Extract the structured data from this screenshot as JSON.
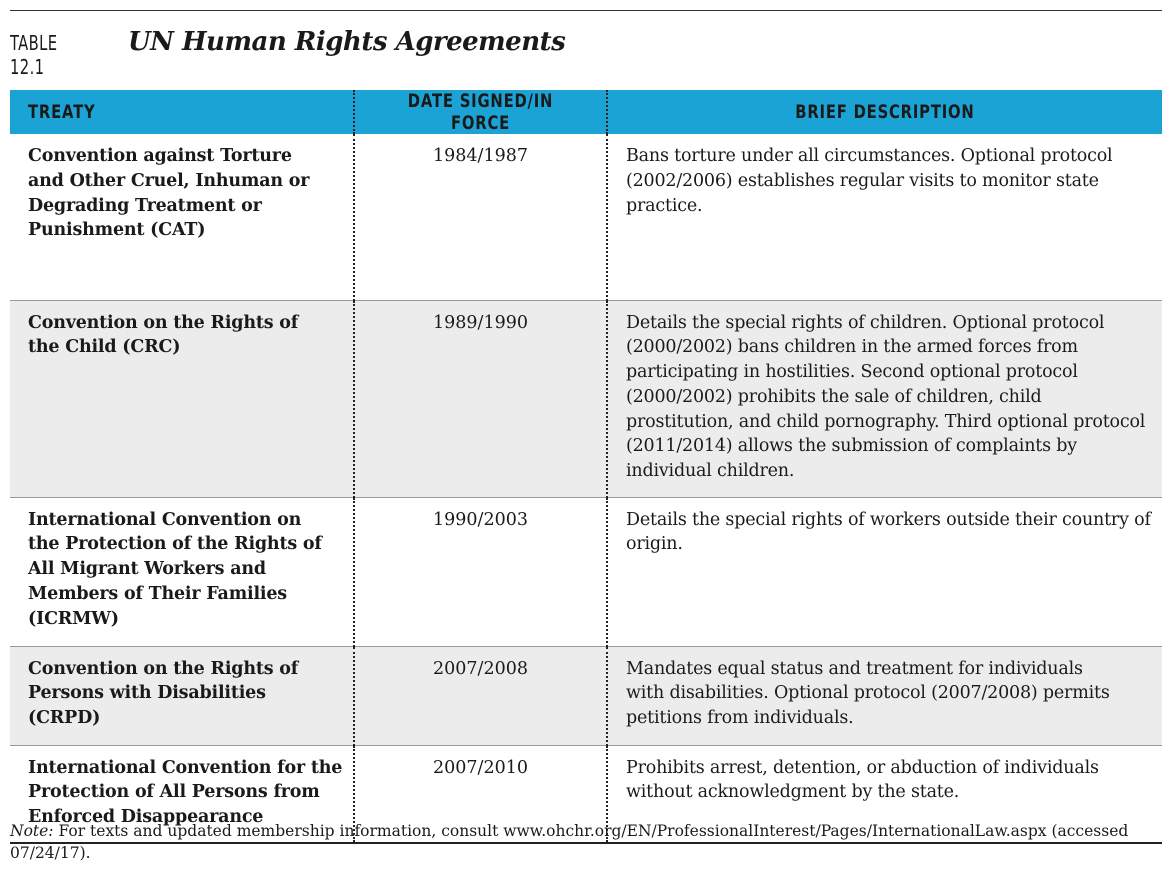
{
  "header": {
    "table_label": "TABLE 12.1",
    "table_title": "UN Human Rights Agreements"
  },
  "table": {
    "columns": [
      "TREATY",
      "DATE SIGNED/IN FORCE",
      "BRIEF DESCRIPTION"
    ],
    "rows": [
      {
        "treaty": "Convention against Torture and Other Cruel, Inhuman or Degrading Treatment or Punishment (CAT)",
        "date": "1984/1987",
        "description": "Bans torture under all circumstances. Optional protocol (2002/2006) establishes regular visits to monitor state practice."
      },
      {
        "treaty": "Convention on the Rights of the Child (CRC)",
        "date": "1989/1990",
        "description": "Details the special rights of children. Optional protocol (2000/2002) bans children in the armed forces from participating in hostilities. Second optional protocol (2000/2002) prohibits the sale of children, child prostitution, and child pornography. Third optional protocol (2011/2014) allows the submission of complaints by individual children."
      },
      {
        "treaty": "International Convention on the Protection of the Rights of All Migrant Workers and Members of Their Families (ICRMW)",
        "date": "1990/2003",
        "description": "Details the special rights of workers outside their country of origin."
      },
      {
        "treaty": "Convention on the Rights of Persons with Disabilities (CRPD)",
        "date": "2007/2008",
        "description": "Mandates equal status and treatment for individuals with disabilities. Optional protocol (2007/2008) permits petitions from individuals."
      },
      {
        "treaty": "International Convention for the Protection of All Persons from Enforced Disappearance",
        "date": "2007/2010",
        "description": "Prohibits arrest, detention, or abduction of individuals without acknowledgment by the state."
      }
    ]
  },
  "note": {
    "label": "Note:",
    "text": "For texts and updated membership information, consult www.ohchr.org/EN/ProfessionalInterest/Pages/InternationalLaw.aspx (accessed 07/24/17)."
  }
}
